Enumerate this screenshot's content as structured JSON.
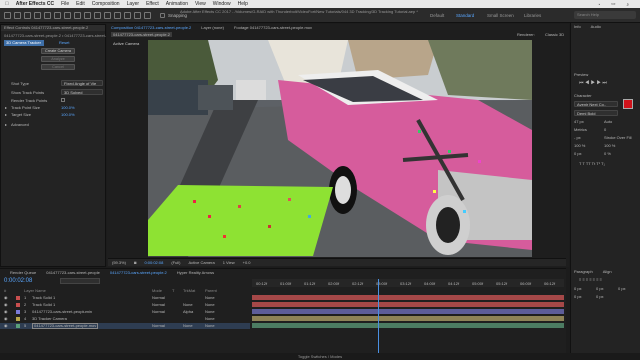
{
  "menubar": {
    "apple": "",
    "app": "After Effects CC",
    "items": [
      "File",
      "Edit",
      "Composition",
      "Layer",
      "Effect",
      "Animation",
      "View",
      "Window",
      "Help"
    ],
    "right": [
      "Search Help"
    ]
  },
  "window_title": "Adobe After Effects CC 2017 - /Volumes/G-RAID with Thunderbolt/VideoFort/New Tutorials/044 3D Tracking/3D Tracking Tutorial.aep *",
  "toolbar": {
    "snapping": "Snapping",
    "workspaces": [
      "Default",
      "Standard",
      "Small Screen",
      "Libraries"
    ],
    "active_workspace": "Standard",
    "search_placeholder": "Search Help"
  },
  "effect_controls": {
    "tab": "Effect Controls 041477723-cars-street-people.2",
    "layer": "041477723-cars-street-people.2 • 041477723-cars-street-",
    "effect": "3D Camera Tracker",
    "reset": "Reset",
    "create_camera": "Create Camera",
    "analyze": "Analyze",
    "cancel": "Cancel",
    "shot_type_label": "Shot Type",
    "shot_type_value": "Fixed Angle of Vie",
    "show_track_points_label": "Show Track Points",
    "show_track_points_value": "3D Solved",
    "render_track_points": "Render Track Points",
    "track_point_size_label": "Track Point Size",
    "track_point_size_value": "100.0%",
    "target_size_label": "Target Size",
    "target_size_value": "100.0%",
    "advanced": "Advanced"
  },
  "viewer": {
    "tabs": [
      "Composition 041477723-cars-street-people.2",
      "Layer (none)",
      "Footage 041477723-cars-street-people.mov"
    ],
    "comp_name": "041477723-cars-street-people.2",
    "renderer": "Renderer:",
    "renderer_value": "Classic 3D",
    "label": "Active Camera"
  },
  "viewer_bar": {
    "zoom": "(59.3%)",
    "timecode": "0:00:02:08",
    "resolution": "(Full)",
    "camera": "Active Camera",
    "views": "1 View",
    "exposure": "+0.0"
  },
  "timeline": {
    "tabs": [
      "Render Queue",
      "041477723-cars-street-people",
      "041477723-cars-street-people.2",
      "Hyper Reality Arrows"
    ],
    "timecode": "0:00:02:08",
    "columns": [
      "#",
      "Layer Name",
      "Mode",
      "T",
      "TrkMat",
      "Parent"
    ],
    "layers": [
      {
        "num": "1",
        "name": "Track Solid 1",
        "mode": "Normal",
        "trk": "",
        "parent": "None",
        "color": "#c94f4f"
      },
      {
        "num": "2",
        "name": "Track Solid 1",
        "mode": "Normal",
        "trk": "None",
        "parent": "None",
        "color": "#c94f4f"
      },
      {
        "num": "3",
        "name": "041477723-cars-street-peoplumin",
        "mode": "Normal",
        "trk": "Alpha",
        "parent": "None",
        "color": "#7a7ad9"
      },
      {
        "num": "4",
        "name": "3D Tracker Camera",
        "mode": "",
        "trk": "",
        "parent": "None",
        "color": "#b8a64a"
      },
      {
        "num": "5",
        "name": "041477723-cars-street-people.mov",
        "mode": "Normal",
        "trk": "None",
        "parent": "None",
        "color": "#5aa07a"
      }
    ],
    "ruler": [
      "00:12f",
      "01:00f",
      "01:12f",
      "02:00f",
      "02:12f",
      "03:00f",
      "03:12f",
      "04:00f",
      "04:12f",
      "05:00f",
      "05:12f",
      "06:00f",
      "06:12f"
    ],
    "toggle": "Toggle Switches / Modes"
  },
  "right_panels": {
    "info": "Info",
    "audio": "Audio",
    "preview": "Preview",
    "character": "Character",
    "font": "Avenir Next Co..",
    "font_style": "Demi Bold",
    "font_size": "47 px",
    "leading": "Auto",
    "kerning": "Metrics",
    "tracking": "0",
    "stroke": "Stroke Over Fill",
    "stroke_width": "- px",
    "percent_a": "100 %",
    "percent_b": "100 %",
    "baseline": "0 px",
    "tsume": "0 %",
    "paragraph": "Paragraph",
    "align": "Align",
    "indent_values": [
      "0 px",
      "0 px",
      "0 px"
    ],
    "space_values": [
      "0 px",
      "0 px"
    ]
  },
  "colors": {
    "accent": "#5aa7ff",
    "solid": "#8ee233",
    "car": "#d65c9c",
    "playhead": "#4a90e2"
  },
  "bottom": "Toggle Switches / Modes"
}
